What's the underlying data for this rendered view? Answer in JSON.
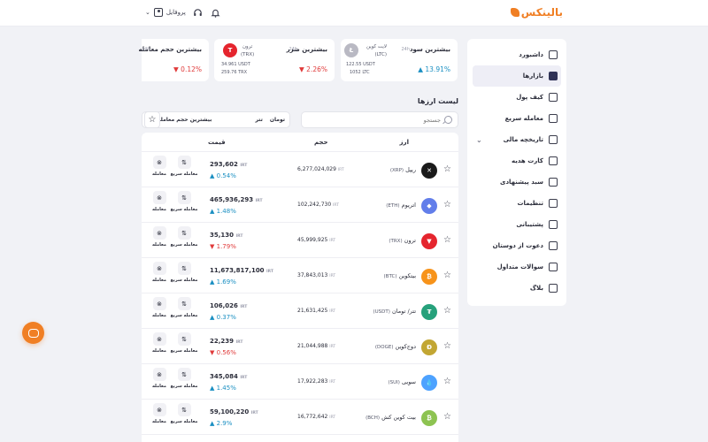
{
  "header": {
    "logo_text": "بالینکس",
    "profile_label": "پروفایل",
    "icons": [
      "bell-icon",
      "headset-icon",
      "user-icon",
      "chevron-down-icon"
    ]
  },
  "sidebar": {
    "items": [
      {
        "label": "داشبورد",
        "icon": "dashboard-icon",
        "active": false
      },
      {
        "label": "بازارها",
        "icon": "markets-icon",
        "active": true
      },
      {
        "label": "کیف پول",
        "icon": "wallet-icon",
        "active": false
      },
      {
        "label": "معامله سریع",
        "icon": "swap-icon",
        "active": false
      },
      {
        "label": "تاریخچه مالی",
        "icon": "history-icon",
        "active": false,
        "has_chevron": true
      },
      {
        "label": "کارت هدیه",
        "icon": "gift-icon",
        "active": false
      },
      {
        "label": "سبد پیشنهادی",
        "icon": "basket-icon",
        "active": false
      },
      {
        "label": "تنظیمات",
        "icon": "settings-icon",
        "active": false
      },
      {
        "label": "پشتیبانی",
        "icon": "support-icon",
        "active": false
      },
      {
        "label": "دعوت از دوستان",
        "icon": "invite-icon",
        "active": false
      },
      {
        "label": "سوالات متداول",
        "icon": "faq-icon",
        "active": false
      },
      {
        "label": "بلاگ",
        "icon": "blog-icon",
        "active": false
      }
    ]
  },
  "stats": {
    "profit": {
      "title": "بیشترین سود",
      "period": "24h",
      "coin_name": "لایت کوین",
      "coin_symbol": "(LTC)",
      "price_usd": "122.55 USDT",
      "price_irt": "1052 LTC",
      "change": "13.91%",
      "color": "#b9b9c3",
      "logo_char": "Ł"
    },
    "loss": {
      "title": "بیشترین ضرر",
      "period": "24h",
      "coin_name": "ترون",
      "coin_symbol": "(TRX)",
      "price_usd": "34.961 USDT",
      "price_irt": "259.76 TRX",
      "change": "2.26%",
      "color": "#e5252e",
      "logo_char": "T"
    },
    "volume": {
      "title": "بیشترین حجم معامله",
      "period": "24h",
      "change": "0.12%"
    }
  },
  "list": {
    "title": "لیست ارزها",
    "search_placeholder": "جستجو",
    "filter_toman": "تومان",
    "filter_tether": "تتر",
    "sort_label": "بیشترین حجم معامله",
    "col_asset": "ارز",
    "col_volume": "حجم",
    "col_price": "قیمت",
    "action_quick": "معامله سریع",
    "action_trade": "معامله",
    "unit": "IRT",
    "rows": [
      {
        "name": "ریپل",
        "symbol": "(XRP)",
        "volume": "6,277,024,029",
        "price": "293,602",
        "change": "0.54%",
        "dir": "pos",
        "color": "#1a1a1a",
        "logo_char": "✕"
      },
      {
        "name": "اتریوم",
        "symbol": "(ETH)",
        "volume": "102,242,730",
        "price": "465,936,293",
        "change": "1.48%",
        "dir": "pos",
        "color": "#627eea",
        "logo_char": "◆"
      },
      {
        "name": "ترون",
        "symbol": "(TRX)",
        "volume": "45,999,925",
        "price": "35,130",
        "change": "1.79%",
        "dir": "neg",
        "color": "#e5252e",
        "logo_char": "▼"
      },
      {
        "name": "بیتکوین",
        "symbol": "(BTC)",
        "volume": "37,843,013",
        "price": "11,673,817,100",
        "change": "1.69%",
        "dir": "pos",
        "color": "#f7931a",
        "logo_char": "₿"
      },
      {
        "name": "تتر/ تومان",
        "symbol": "(USDT)",
        "volume": "21,631,425",
        "price": "106,026",
        "change": "0.37%",
        "dir": "pos",
        "color": "#26a17b",
        "logo_char": "₮"
      },
      {
        "name": "دوج‌کوین",
        "symbol": "(DOGE)",
        "volume": "21,044,988",
        "price": "22,239",
        "change": "0.56%",
        "dir": "neg",
        "color": "#c2a633",
        "logo_char": "Ð"
      },
      {
        "name": "سویی",
        "symbol": "(SUI)",
        "volume": "17,922,283",
        "price": "345,084",
        "change": "1.45%",
        "dir": "pos",
        "color": "#4da2ff",
        "logo_char": "💧"
      },
      {
        "name": "بیت کوین کش",
        "symbol": "(BCH)",
        "volume": "16,772,642",
        "price": "59,100,220",
        "change": "2.9%",
        "dir": "pos",
        "color": "#8dc351",
        "logo_char": "₿"
      }
    ]
  },
  "colors": {
    "accent": "#f07f24",
    "positive": "#1a8fc2",
    "negative": "#e03a3a"
  }
}
